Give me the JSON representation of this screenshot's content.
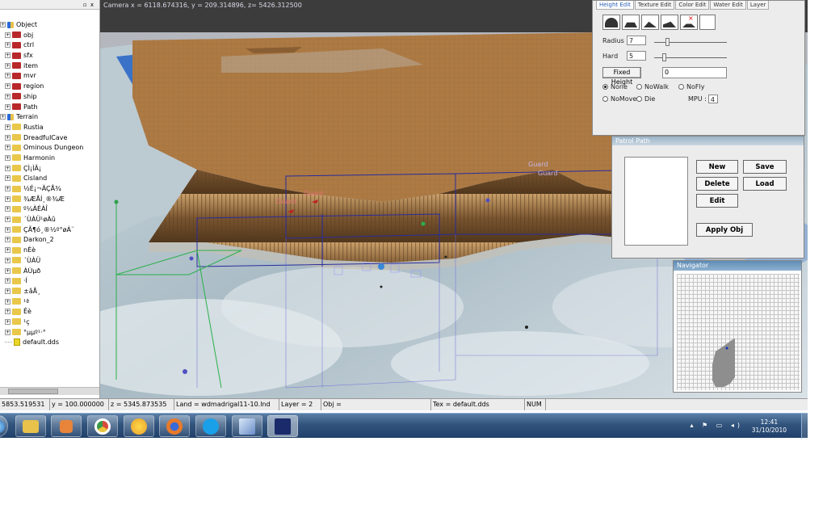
{
  "viewport": {
    "camera": "Camera x = 6118.674316, y = 209.314896, z= 5426.312500",
    "labels": [
      "Guard",
      "Guard",
      "Guard",
      "Guard"
    ]
  },
  "tree": {
    "controls": "▫ x",
    "items": [
      {
        "label": "Object",
        "level": 0,
        "icon": "object-root"
      },
      {
        "label": "obj",
        "level": 1,
        "icon": "red-folder"
      },
      {
        "label": "ctrl",
        "level": 1,
        "icon": "red-folder"
      },
      {
        "label": "sfx",
        "level": 1,
        "icon": "red-folder"
      },
      {
        "label": "item",
        "level": 1,
        "icon": "red-folder"
      },
      {
        "label": "mvr",
        "level": 1,
        "icon": "red-folder"
      },
      {
        "label": "region",
        "level": 1,
        "icon": "red-folder"
      },
      {
        "label": "ship",
        "level": 1,
        "icon": "red-folder"
      },
      {
        "label": "Path",
        "level": 1,
        "icon": "red-folder"
      },
      {
        "label": "Terrain",
        "level": 0,
        "icon": "terrain-root"
      },
      {
        "label": "Rustia",
        "level": 1,
        "icon": "yellow-folder"
      },
      {
        "label": "DreadfulCave",
        "level": 1,
        "icon": "yellow-folder"
      },
      {
        "label": "Ominous Dungeon",
        "level": 1,
        "icon": "yellow-folder"
      },
      {
        "label": "Harmonin",
        "level": 1,
        "icon": "yellow-folder"
      },
      {
        "label": "ÇÌ¡ÌÂ¡",
        "level": 1,
        "icon": "yellow-folder"
      },
      {
        "label": "Cisland",
        "level": 1,
        "icon": "yellow-folder"
      },
      {
        "label": "½É¡¬ÄÇÅ¾",
        "level": 1,
        "icon": "yellow-folder"
      },
      {
        "label": "¾ÆÅÍ¸®¾Æ",
        "level": 1,
        "icon": "yellow-folder"
      },
      {
        "label": "º¼ÀÉÀÎ",
        "level": 1,
        "icon": "yellow-folder"
      },
      {
        "label": "´ÙÀÜ¹øÀû",
        "level": 1,
        "icon": "yellow-folder"
      },
      {
        "label": "ÇÃ¶ó¸®½º°øÁ¨",
        "level": 1,
        "icon": "yellow-folder"
      },
      {
        "label": "Darkon_2",
        "level": 1,
        "icon": "yellow-folder"
      },
      {
        "label": "nÉè",
        "level": 1,
        "icon": "yellow-folder"
      },
      {
        "label": "´ÙÀÜ",
        "level": 1,
        "icon": "yellow-folder"
      },
      {
        "label": "ÀÙµð",
        "level": 1,
        "icon": "yellow-folder"
      },
      {
        "label": "·Í",
        "level": 1,
        "icon": "yellow-folder"
      },
      {
        "label": "±âÅ¸",
        "level": 1,
        "icon": "yellow-folder"
      },
      {
        "label": "¹ª",
        "level": 1,
        "icon": "yellow-folder"
      },
      {
        "label": "Êè",
        "level": 1,
        "icon": "yellow-folder"
      },
      {
        "label": "¹ç",
        "level": 1,
        "icon": "yellow-folder"
      },
      {
        "label": "°µµº¹·°",
        "level": 1,
        "icon": "yellow-folder"
      },
      {
        "label": "default.dds",
        "level": 1,
        "icon": "file"
      }
    ]
  },
  "height_panel": {
    "tabs": [
      "Height Edit",
      "Texture Edit",
      "Color Edit",
      "Water Edit",
      "Layer"
    ],
    "radius_label": "Radius",
    "radius_value": "7",
    "hard_label": "Hard",
    "hard_value": "5",
    "fixed_height_button": "Fixed Height",
    "fixed_height_value": "0",
    "radio_none": "None",
    "radio_nowalk": "NoWalk",
    "radio_nofly": "NoFly",
    "radio_nomove": "NoMove",
    "radio_die": "Die",
    "mpu_label": "MPU :",
    "mpu_value": "4"
  },
  "patrol": {
    "title": "Patrol Path",
    "new": "New",
    "save": "Save",
    "delete": "Delete",
    "load": "Load",
    "edit": "Edit",
    "apply": "Apply Obj"
  },
  "navigator": {
    "title": "Navigator"
  },
  "status": {
    "x": "5853.519531",
    "y": "y = 100.000000",
    "z": "z = 5345.873535",
    "land": "Land = wdmadrigal11-10.lnd",
    "layer": "Layer = 2",
    "obj": "Obj =",
    "tex": "Tex = default.dds",
    "num": "NUM"
  },
  "taskbar": {
    "time": "12:41",
    "date": "31/10/2010",
    "apps": [
      "start",
      "explorer",
      "media-player",
      "chrome",
      "messenger",
      "firefox",
      "skype",
      "editor",
      "world-editor"
    ]
  },
  "colors": {
    "terrain": "#b07a45",
    "water": "#3a72c8",
    "taskbar": "#2c4f78",
    "accent": "#2a5fb5"
  }
}
